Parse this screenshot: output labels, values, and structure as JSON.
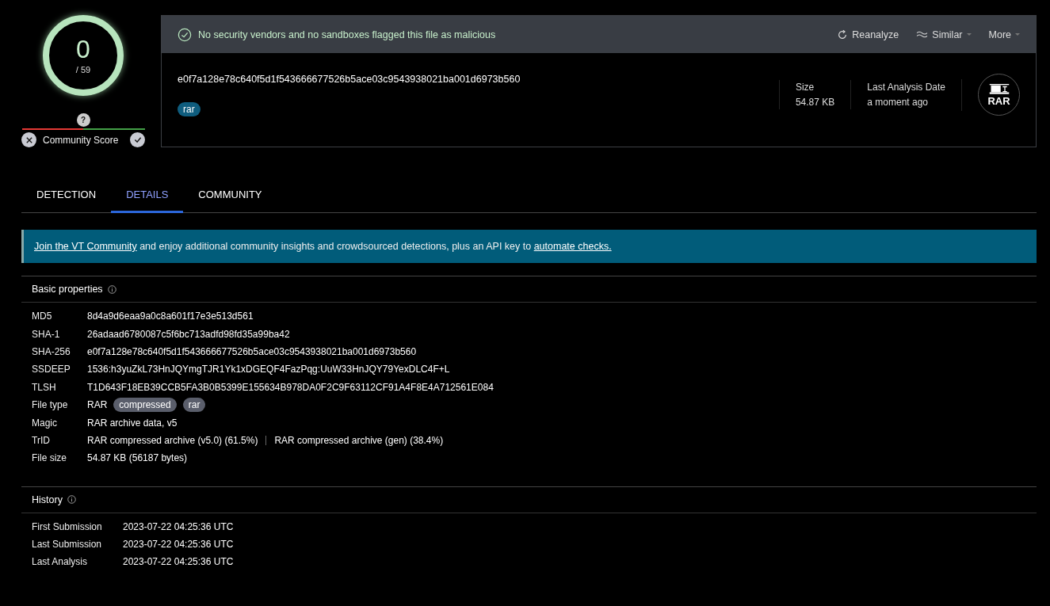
{
  "score": {
    "detections": "0",
    "total": "/ 59"
  },
  "community_score": {
    "label": "Community Score",
    "marker": "?"
  },
  "verdict": "No security vendors and no sandboxes flagged this file as malicious",
  "actions": [
    {
      "label": "Reanalyze",
      "kind": "reanalyze",
      "dropdown": false
    },
    {
      "label": "Similar",
      "kind": "similar",
      "dropdown": true
    },
    {
      "label": "More",
      "kind": "more",
      "dropdown": true
    }
  ],
  "file": {
    "hash": "e0f7a128e78c640f5d1f543666677526b5ace03c9543938021ba001d6973b560",
    "tags": [
      "rar"
    ],
    "stats": [
      {
        "label": "Size",
        "value": "54.87 KB"
      },
      {
        "label": "Last Analysis Date",
        "value": "a moment ago"
      }
    ],
    "type_badge": "RAR"
  },
  "tabs": [
    {
      "label": "DETECTION",
      "selected": false
    },
    {
      "label": "DETAILS",
      "selected": true
    },
    {
      "label": "COMMUNITY",
      "selected": false
    }
  ],
  "banner": {
    "link_start": "Join the VT Community",
    "text": " and enjoy additional community insights and crowdsourced detections, plus an API key to ",
    "link_end": "automate checks."
  },
  "basic_properties": {
    "title": "Basic properties",
    "rows": [
      {
        "kind": "text",
        "label": "MD5",
        "value": "8d4a9d6eaa9a0c8a601f17e3e513d561"
      },
      {
        "kind": "text",
        "label": "SHA-1",
        "value": "26adaad6780087c5f6bc713adfd98fd35a99ba42"
      },
      {
        "kind": "text",
        "label": "SHA-256",
        "value": "e0f7a128e78c640f5d1f543666677526b5ace03c9543938021ba001d6973b560"
      },
      {
        "kind": "text",
        "label": "SSDEEP",
        "value": "1536:h3yuZkL73HnJQYmgTJR1Yk1xDGEQF4FazPqg:UuW33HnJQY79YexDLC4F+L"
      },
      {
        "kind": "text",
        "label": "TLSH",
        "value": "T1D643F18EB39CCB5FA3B0B5399E155634B978DA0F2C9F63112CF91A4F8E4A712561E084"
      },
      {
        "kind": "tags",
        "label": "File type",
        "value": "RAR",
        "tags": [
          "compressed",
          "rar"
        ]
      },
      {
        "kind": "text",
        "label": "Magic",
        "value": "RAR archive data, v5"
      },
      {
        "kind": "parts",
        "label": "TrID",
        "parts": [
          "RAR compressed archive (v5.0) (61.5%)",
          "RAR compressed archive (gen) (38.4%)"
        ]
      },
      {
        "kind": "text",
        "label": "File size",
        "value": "54.87 KB (56187 bytes)"
      }
    ]
  },
  "history": {
    "title": "History",
    "rows": [
      {
        "label": "First Submission",
        "value": "2023-07-22 04:25:36 UTC"
      },
      {
        "label": "Last Submission",
        "value": "2023-07-22 04:25:36 UTC"
      },
      {
        "label": "Last Analysis",
        "value": "2023-07-22 04:25:36 UTC"
      }
    ]
  }
}
